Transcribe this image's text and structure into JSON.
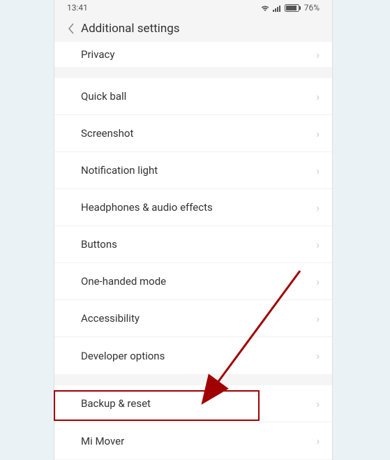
{
  "status": {
    "time": "13:41",
    "battery_pct": "76%"
  },
  "header": {
    "title": "Additional  settings"
  },
  "rows": {
    "privacy": "Privacy",
    "quickball": "Quick ball",
    "screenshot": "Screenshot",
    "notiflight": "Notification light",
    "headphones": "Headphones & audio effects",
    "buttons": "Buttons",
    "onehanded": "One-handed mode",
    "accessibility": "Accessibility",
    "devoptions": "Developer options",
    "backupreset": "Backup & reset",
    "mimover": "Mi Mover"
  },
  "annotation": {
    "highlight_target": "backup-reset-row"
  }
}
